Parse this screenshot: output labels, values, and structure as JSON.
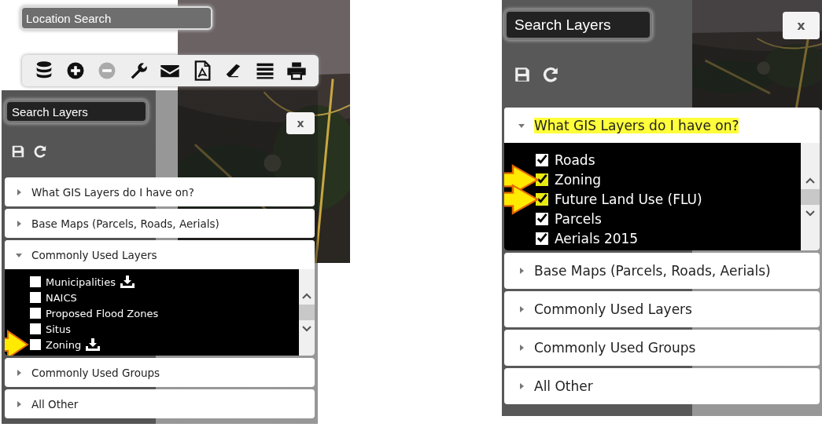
{
  "panels": [
    {
      "location_search": {
        "placeholder": "Location Search"
      },
      "toolbar": [
        {
          "disabled": false
        },
        {
          "disabled": false
        },
        {
          "disabled": true
        },
        {
          "disabled": false
        },
        {
          "disabled": false
        },
        {
          "disabled": false
        },
        {
          "disabled": false
        },
        {
          "disabled": false
        },
        {
          "disabled": false
        }
      ],
      "search": {
        "placeholder": "Search Layers"
      },
      "close": "x",
      "sections": [
        {
          "label": "What GIS Layers do I have on?",
          "expanded": false,
          "highlighted": false
        },
        {
          "label": "Base Maps (Parcels, Roads, Aerials)",
          "expanded": false,
          "highlighted": false
        },
        {
          "label": "Commonly Used Layers",
          "expanded": true,
          "highlighted": false,
          "layers": [
            {
              "label": "Municipalities",
              "checked": false,
              "highlighted": false,
              "download": true,
              "arrow": false
            },
            {
              "label": "NAICS",
              "checked": false,
              "highlighted": false,
              "download": false,
              "arrow": false
            },
            {
              "label": "Proposed Flood Zones",
              "checked": false,
              "highlighted": false,
              "download": false,
              "arrow": false
            },
            {
              "label": "Situs",
              "checked": false,
              "highlighted": false,
              "download": false,
              "arrow": false
            },
            {
              "label": "Zoning",
              "checked": false,
              "highlighted": false,
              "download": true,
              "arrow": true
            }
          ]
        },
        {
          "label": "Commonly Used Groups",
          "expanded": false,
          "highlighted": false
        },
        {
          "label": "All Other",
          "expanded": false,
          "highlighted": false
        }
      ]
    },
    {
      "search": {
        "placeholder": "Search Layers"
      },
      "close": "x",
      "sections": [
        {
          "label": "What GIS Layers do I have on?",
          "expanded": true,
          "highlighted": true,
          "layers": [
            {
              "label": "Roads",
              "checked": true,
              "highlighted": false,
              "download": false,
              "arrow": false
            },
            {
              "label": "Zoning",
              "checked": true,
              "highlighted": true,
              "download": false,
              "arrow": true
            },
            {
              "label": "Future Land Use (FLU)",
              "checked": true,
              "highlighted": true,
              "download": false,
              "arrow": true
            },
            {
              "label": "Parcels",
              "checked": true,
              "highlighted": false,
              "download": false,
              "arrow": false
            },
            {
              "label": "Aerials 2015",
              "checked": true,
              "highlighted": false,
              "download": false,
              "arrow": false
            }
          ]
        },
        {
          "label": "Base Maps (Parcels, Roads, Aerials)",
          "expanded": false,
          "highlighted": false
        },
        {
          "label": "Commonly Used Layers",
          "expanded": false,
          "highlighted": false
        },
        {
          "label": "Commonly Used Groups",
          "expanded": false,
          "highlighted": false
        },
        {
          "label": "All Other",
          "expanded": false,
          "highlighted": false
        }
      ]
    }
  ]
}
